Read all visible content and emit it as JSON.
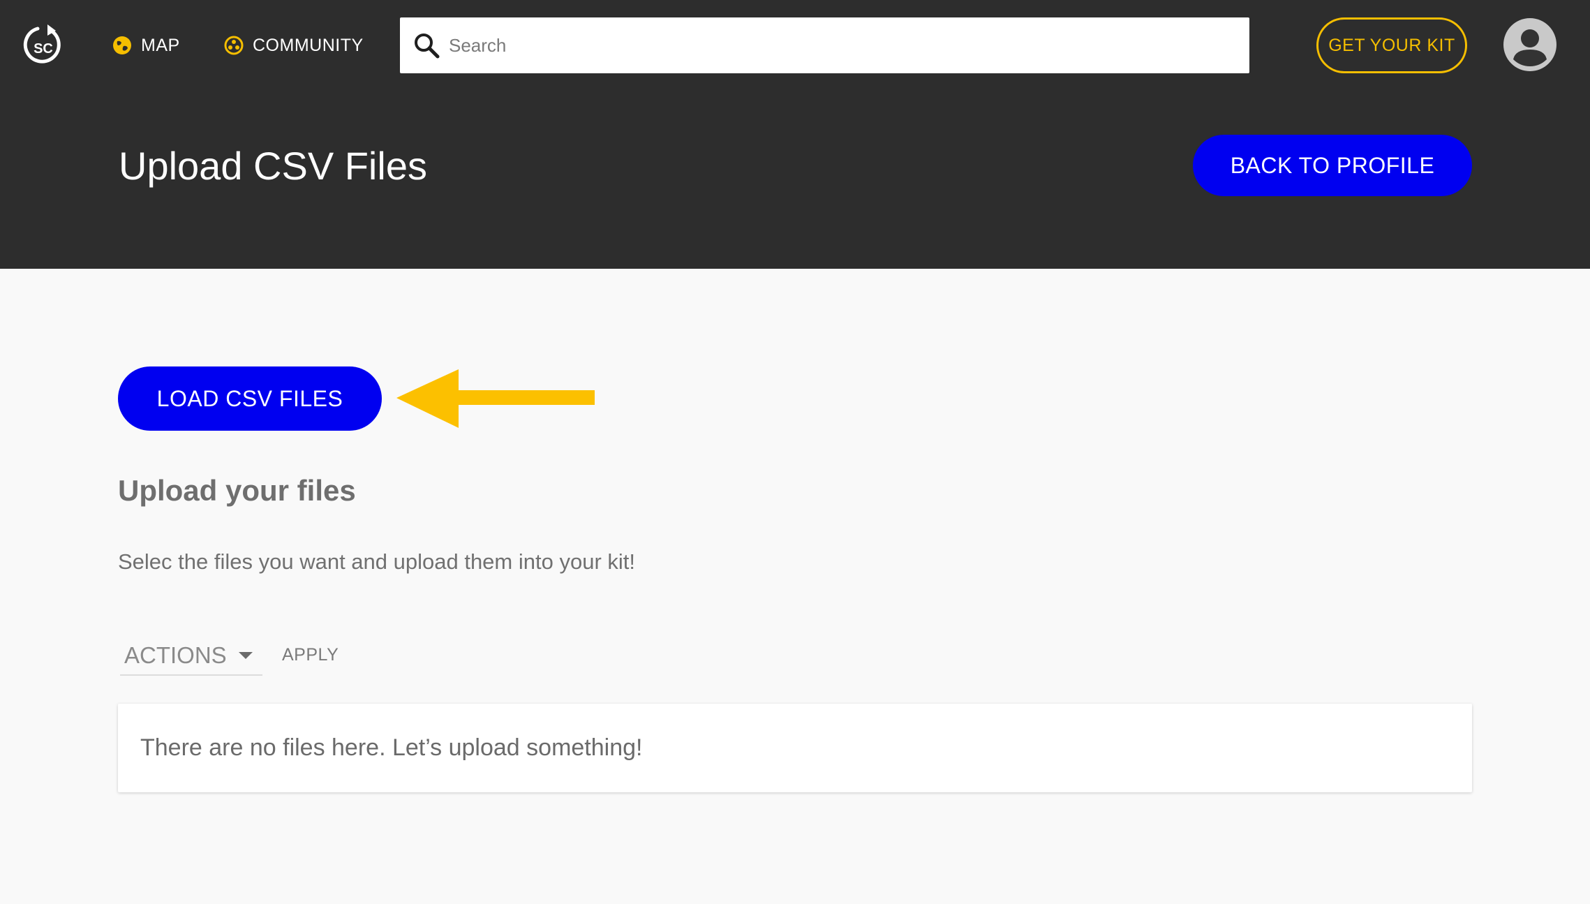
{
  "colors": {
    "header_bg": "#2d2d2d",
    "accent_yellow": "#f5be00",
    "primary_blue": "#0000f0",
    "page_bg": "#f9f9f9"
  },
  "header": {
    "logo_text": "SC",
    "nav": [
      {
        "label": "MAP",
        "icon": "globe-icon"
      },
      {
        "label": "COMMUNITY",
        "icon": "community-icon"
      }
    ],
    "search": {
      "placeholder": "Search",
      "value": "",
      "icon": "search-icon"
    },
    "kit_button": "GET YOUR KIT",
    "avatar_icon": "user-avatar-icon"
  },
  "page": {
    "title": "Upload CSV Files",
    "back_button": "BACK TO PROFILE"
  },
  "main": {
    "load_button": "LOAD CSV FILES",
    "pointer_icon": "arrow-left-icon",
    "section_title": "Upload your files",
    "section_desc": "Selec the files you want and upload them into your kit!",
    "actions": {
      "selected": "ACTIONS",
      "apply_label": "APPLY"
    },
    "empty_message": "There are no files here. Let’s upload something!"
  }
}
